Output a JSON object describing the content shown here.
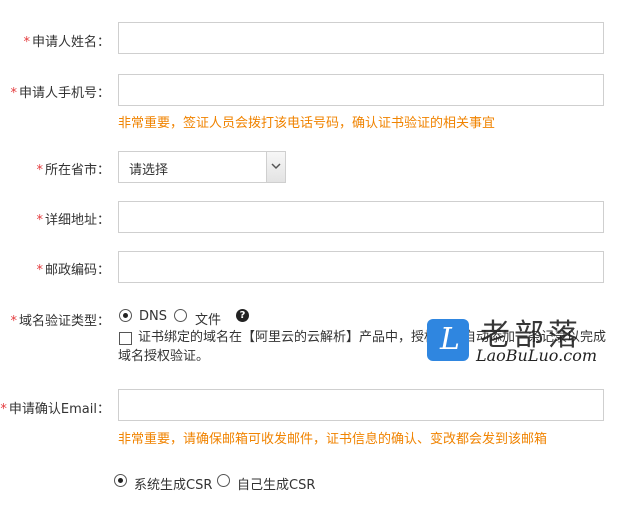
{
  "fields": {
    "applicant_name": {
      "label": "申请人姓名："
    },
    "applicant_phone": {
      "label": "申请人手机号：",
      "hint": "非常重要，签证人员会拨打该电话号码，确认证书验证的相关事宜"
    },
    "province": {
      "label": "所在省市：",
      "selected": "请选择"
    },
    "address": {
      "label": "详细地址："
    },
    "postcode": {
      "label": "邮政编码："
    },
    "domain_validation": {
      "label": "域名验证类型：",
      "options": [
        "DNS",
        "文件"
      ],
      "selected": "DNS",
      "checkbox_text": "证书绑定的域名在【阿里云的云解析】产品中，授权系统自动添加一条记录以完成域名授权验证。",
      "checked": false
    },
    "confirm_email": {
      "label": "申请确认Email：",
      "hint": "非常重要，请确保邮箱可收发邮件，证书信息的确认、变改都会发到该邮箱"
    },
    "csr": {
      "options": [
        "系统生成CSR",
        "自己生成CSR"
      ],
      "selected": "系统生成CSR"
    }
  },
  "watermark": {
    "logo_letter": "L",
    "cn": "老部落",
    "en": "LaoBuLuo.com"
  },
  "colors": {
    "required_star": "#e4393c",
    "hint": "#f08300",
    "logo": "#2f86e0"
  }
}
